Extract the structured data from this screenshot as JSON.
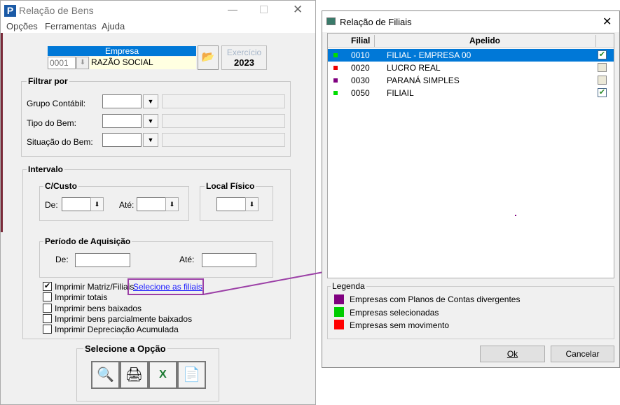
{
  "main_window": {
    "title": "Relação de Bens",
    "menu": [
      "Opções",
      "Ferramentas",
      "Ajuda"
    ],
    "empresa": {
      "header": "Empresa",
      "code": "0001",
      "name": "RAZÃO SOCIAL"
    },
    "exercicio": {
      "label": "Exercício",
      "value": "2023"
    },
    "filtrar": {
      "title": "Filtrar por",
      "fields": [
        "Grupo Contábil:",
        "Tipo do Bem:",
        "Situação do Bem:"
      ]
    },
    "intervalo": {
      "title": "Intervalo",
      "ccusto": {
        "title": "C/Custo",
        "de": "De:",
        "ate": "Até:"
      },
      "local": {
        "title": "Local Físico"
      },
      "periodo": {
        "title": "Período de Aquisição",
        "de": "De:",
        "ate": "Até:"
      }
    },
    "options": [
      {
        "label": "Imprimir Matriz/Filiais",
        "checked": true
      },
      {
        "label": "Imprimir totais",
        "checked": false
      },
      {
        "label": "Imprimir bens baixados",
        "checked": false
      },
      {
        "label": "Imprimir bens parcialmente baixados",
        "checked": false
      },
      {
        "label": "Imprimir Depreciação Acumulada",
        "checked": false
      }
    ],
    "link": "Selecione as filiais",
    "selecione": {
      "title": "Selecione a Opção",
      "icons": [
        "preview-icon",
        "print-icon",
        "excel-export-icon",
        "text-export-icon"
      ]
    }
  },
  "dialog": {
    "title": "Relação de Filiais",
    "columns": [
      "Filial",
      "Apelido"
    ],
    "rows": [
      {
        "color": "#00dd00",
        "filial": "0010",
        "apelido": "FILIAL - EMPRESA 00",
        "checked": true,
        "selected": true
      },
      {
        "color": "#ee0000",
        "filial": "0020",
        "apelido": "LUCRO REAL",
        "checked": false,
        "selected": false
      },
      {
        "color": "#800080",
        "filial": "0030",
        "apelido": "PARANÁ SIMPLES",
        "checked": false,
        "selected": false
      },
      {
        "color": "#00dd00",
        "filial": "0050",
        "apelido": "FILIAIL",
        "checked": true,
        "selected": false
      }
    ],
    "legend": {
      "title": "Legenda",
      "items": [
        {
          "color": "#800080",
          "label": "Empresas com Planos de Contas divergentes"
        },
        {
          "color": "#00cc00",
          "label": "Empresas selecionadas"
        },
        {
          "color": "#ff0000",
          "label": "Empresas sem movimento"
        }
      ]
    },
    "ok": "Ok",
    "cancel": "Cancelar"
  },
  "colors": {
    "accent": "#0078d7",
    "annotation": "#9b3fa6"
  }
}
